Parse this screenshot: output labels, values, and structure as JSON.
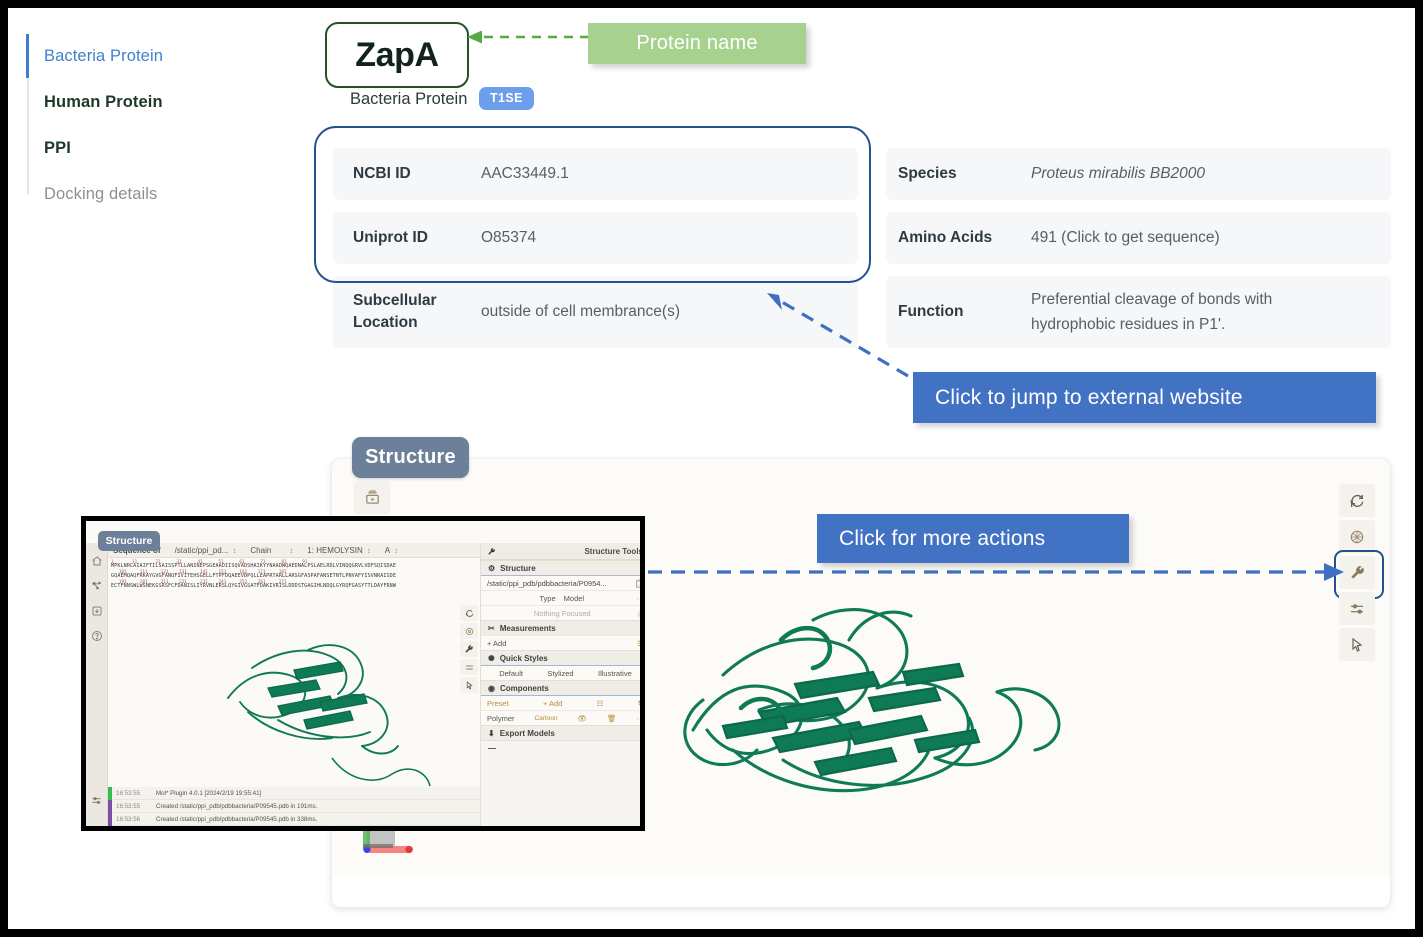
{
  "sidebar": {
    "items": [
      {
        "label": "Bacteria Protein",
        "state": "active"
      },
      {
        "label": "Human Protein",
        "state": "bold"
      },
      {
        "label": "PPI",
        "state": "bold"
      },
      {
        "label": "Docking details",
        "state": "muted"
      }
    ]
  },
  "header": {
    "protein_name": "ZapA",
    "subtitle": "Bacteria Protein",
    "type_badge": "T1SE"
  },
  "callouts": {
    "protein_name": "Protein name",
    "external_website": "Click to jump to external website",
    "more_actions": "Click for more actions"
  },
  "colors": {
    "accent_blue": "#4272c4",
    "callout_green": "#a7d18e",
    "highlight_border": "#23528f",
    "name_border": "#255127",
    "badge_blue": "#6d9eeb",
    "tag_slate": "#6c8099",
    "protein_green": "#0f7a56"
  },
  "info_left": [
    {
      "key": "NCBI ID",
      "value": "AAC33449.1",
      "italic": false,
      "tall": false
    },
    {
      "key": "Uniprot ID",
      "value": "O85374",
      "italic": false,
      "tall": false
    },
    {
      "key": "Subcellular Location",
      "value": "outside of cell membrance(s)",
      "italic": false,
      "tall": true
    }
  ],
  "info_right": [
    {
      "key": "Species",
      "value": "Proteus mirabilis BB2000",
      "italic": true,
      "tall": false
    },
    {
      "key": "Amino Acids",
      "value": "491 (Click to get sequence)",
      "italic": false,
      "tall": false
    },
    {
      "key": "Function",
      "value": "Preferential cleavage of bonds with hydrophobic residues in P1'.",
      "italic": false,
      "tall": true
    }
  ],
  "structure": {
    "tag": "Structure",
    "toolbar_icons": [
      "reset-icon",
      "focus-icon",
      "wrench-icon",
      "sliders-icon",
      "cursor-icon"
    ],
    "screenshot_icon": "snapshot-icon"
  },
  "inset": {
    "tag": "Structure",
    "sequence_header": {
      "label": "Sequence of",
      "source": "/static/ppi_pd...",
      "chain_label": "Chain",
      "chain_value": "1: HEMOLYSIN",
      "sub_chain": "A"
    },
    "sequence_lines": [
      "MPKLNRCAIAIFTILSAISSPTLLANINEPSGEAADIISQVADSHAIKYYNAADWQAEDNALPSLAELRDLVINQQGRVLVDFSQISDAE",
      "GQAEMQAQFRKAYGVGFANQFIVITEHSGELLFTPFDQAEEVDPQLLEAPRTARLLARSGFASPAFANSETNTLPNVAFYISVNRAISDE",
      "ECTFNNSWLWSNEKGSRSFCFDANISLIYRVNLERSLQYGIVGSATFDAKIVRISLDDDSTGAGIHLNDQLGYRQFGASYTTLDAYFRNW"
    ],
    "sequence_numbers": [
      "1",
      "11",
      "21",
      "31",
      "41",
      "51",
      "61",
      "71",
      "81",
      "91"
    ],
    "tools_title": "Structure Tools",
    "sections": [
      {
        "title": "Structure",
        "rows": [
          {
            "text": "/static/ppi_pdb/pdbbacteria/P0954...",
            "right": "copy-icon",
            "style": "path"
          },
          {
            "text": "Type",
            "right": "Model",
            "style": "normal"
          },
          {
            "text": "Nothing Focused",
            "right": "focus-icon",
            "style": "muted"
          }
        ]
      },
      {
        "title": "Measurements",
        "rows": [
          {
            "text": "+  Add",
            "right": "settings-icon",
            "style": "normal"
          }
        ]
      },
      {
        "title": "Quick Styles",
        "rows": [
          {
            "text": "Default",
            "mid": "Stylized",
            "right": "Illustrative",
            "style": "ctr"
          }
        ]
      },
      {
        "title": "Components",
        "rows": [
          {
            "text": "Preset",
            "mid": "+ Add",
            "right": "settings-icon",
            "style": "normal"
          },
          {
            "text": "Polymer",
            "mid": "Cartoon",
            "right": "eye-icon",
            "style": "normal"
          }
        ]
      },
      {
        "title": "Export Models",
        "rows": []
      }
    ],
    "log": [
      {
        "time": "16:53:55",
        "text": "Mol* Plugin 4.0.1 [2024/2/19 19:55:41]",
        "color": "#2fbf4f"
      },
      {
        "time": "16:53:55",
        "text": "Created /static/ppi_pdb/pdbbacteria/P09545.pdb in 191ms.",
        "color": "#7b4ea8"
      },
      {
        "time": "16:53:56",
        "text": "Created /static/ppi_pdb/pdbbacteria/P09545.pdb in 338ms.",
        "color": "#7b4ea8"
      }
    ],
    "rail_icons": [
      "home-icon",
      "molecule-icon",
      "download-icon",
      "help-icon"
    ],
    "toolbar_icons": [
      "reset-icon",
      "focus-icon",
      "wrench-icon",
      "sliders-icon",
      "cursor-icon"
    ]
  }
}
